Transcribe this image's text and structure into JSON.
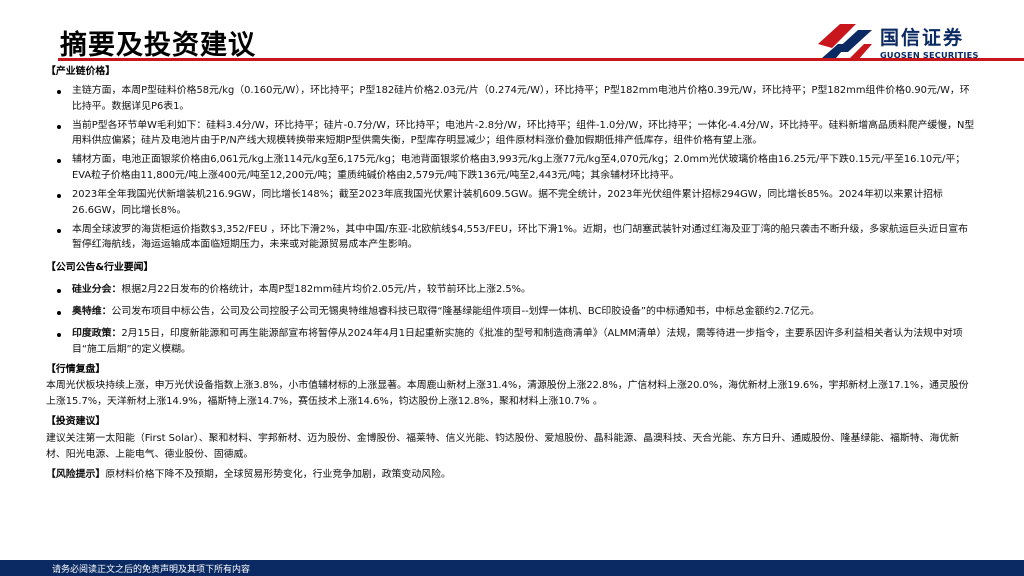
{
  "header": {
    "title": "摘要及投资建议",
    "logo": {
      "name_cn": "国信证券",
      "name_en": "GUOSEN SECURITIES",
      "brand_colors": {
        "red": "#c9161d",
        "navy": "#0b2a63"
      }
    }
  },
  "sections": {
    "industry_prices": {
      "title": "【产业链价格】",
      "items": [
        "主链方面，本周P型硅料价格58元/kg（0.160元/W），环比持平；P型182硅片价格2.03元/片（0.274元/W），环比持平；P型182mm电池片价格0.39元/W，环比持平；P型182mm组件价格0.90元/W，环比持平。数据详见P6表1。",
        "当前P型各环节单W毛利如下：硅料3.4分/W，环比持平；硅片-0.7分/W，环比持平；电池片-2.8分/W，环比持平；组件-1.0分/W，环比持平；一体化-4.4分/W，环比持平。硅料新增高品质料爬产缓慢，N型用料供应偏紧；硅片及电池片由于P/N产线大规模转换带来短期P型供需失衡，P型库存明显减少；组件原材料涨价叠加假期低排产低库存，组件价格有望上涨。",
        "辅材方面，电池正面银浆价格由6,061元/kg上涨114元/kg至6,175元/kg；电池背面银浆价格由3,993元/kg上涨77元/kg至4,070元/kg；2.0mm光伏玻璃价格由16.25元/平下跌0.15元/平至16.10元/平；EVA粒子价格由11,800元/吨上涨400元/吨至12,200元/吨；重质纯碱价格由2,579元/吨下跌136元/吨至2,443元/吨；其余辅材环比持平。",
        "2023年全年我国光伏新增装机216.9GW，同比增长148%；截至2023年底我国光伏累计装机609.5GW。据不完全统计，2023年光伏组件累计招标294GW，同比增长85%。2024年初以来累计招标26.6GW，同比增长8%。",
        "本周全球波罗的海货柜运价指数$3,352/FEU ，环比下滑2%，其中中国/东亚-北欧航线$4,553/FEU，环比下滑1%。近期，也门胡塞武装针对通过红海及亚丁湾的船只袭击不断升级，多家航运巨头近日宣布暂停红海航线，海运运输成本面临短期压力，未来或对能源贸易成本产生影响。"
      ]
    },
    "announcements": {
      "title": "【公司公告&行业要闻】",
      "items": [
        {
          "lead": "硅业分会：",
          "text": "根据2月22日发布的价格统计，本周P型182mm硅片均价2.05元/片，较节前环比上涨2.5%。"
        },
        {
          "lead": "奥特维：",
          "text": "公司发布项目中标公告，公司及公司控股子公司无锡奥特维旭睿科技已取得“隆基绿能组件项目--划焊一体机、BC印胶设备”的中标通知书，中标总金额约2.7亿元。"
        },
        {
          "lead": "印度政策：",
          "text": "2月15日，印度新能源和可再生能源部宣布将暂停从2024年4月1日起重新实施的《批准的型号和制造商清单》（ALMM清单）法规，需等待进一步指令，主要系因许多利益相关者认为法规中对项目“施工后期”的定义模糊。"
        }
      ]
    },
    "market_review": {
      "title": "【行情复盘】",
      "text": "本周光伏板块持续上涨，申万光伏设备指数上涨3.8%，小市值辅材标的上涨显著。本周鹿山新材上涨31.4%，清源股份上涨22.8%，广信材料上涨20.0%，海优新材上涨19.6%，宇邦新材上涨17.1%，通灵股份上涨15.7%，天洋新材上涨14.9%，福斯特上涨14.7%，赛伍技术上涨14.6%，钧达股份上涨12.8%，聚和材料上涨10.7% 。"
    },
    "investment": {
      "title": "【投资建议】",
      "text": "建议关注第一太阳能（First Solar）、聚和材料、宇邦新材、迈为股份、金博股份、福莱特、信义光能、钧达股份、爱旭股份、晶科能源、晶澳科技、天合光能、东方日升、通威股份、隆基绿能、福斯特、海优新材、阳光电源、上能电气、德业股份、固德威。"
    },
    "risk": {
      "title": "【风险提示】",
      "text": "原材料价格下降不及预期，全球贸易形势变化，行业竞争加剧，政策变动风险。"
    }
  },
  "footer": {
    "disclaimer": "请务必阅读正文之后的免责声明及其项下所有内容"
  }
}
